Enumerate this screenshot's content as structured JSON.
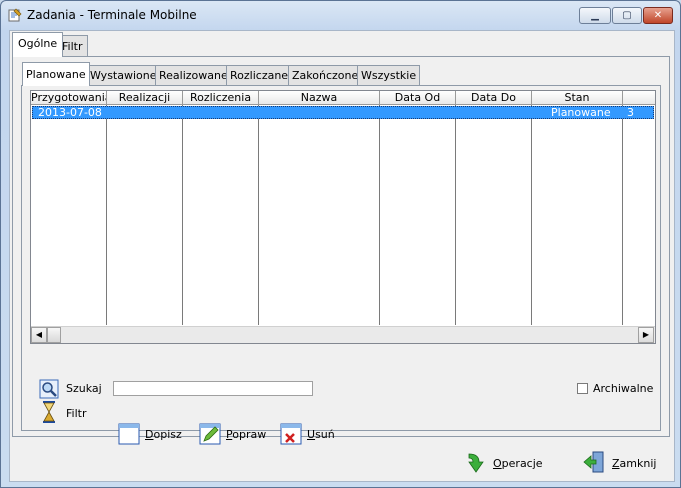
{
  "window": {
    "title": "Zadania - Terminale Mobilne",
    "controls": {
      "minimize": "▁",
      "maximize": "▢",
      "close": "✕"
    }
  },
  "outer_tabs": [
    "Ogólne",
    "Filtr"
  ],
  "inner_tabs": [
    "Planowane",
    "Wystawione",
    "Realizowane",
    "Rozliczane",
    "Zakończone",
    "Wszystkie"
  ],
  "grid": {
    "columns": [
      "Przygotowania",
      "Realizacji",
      "Rozliczenia",
      "Nazwa",
      "Data Od",
      "Data Do",
      "Stan",
      ""
    ],
    "rows": [
      {
        "przygotowania": "2013-07-08",
        "stan": "Planowane",
        "extra": "3"
      }
    ],
    "scroll": {
      "left": "◀",
      "right": "▶"
    }
  },
  "search": {
    "label": "Szukaj",
    "value": ""
  },
  "filter": {
    "label": "Filtr"
  },
  "archive": {
    "label": "Archiwalne",
    "checked": false
  },
  "actions": {
    "add": {
      "label": "Dopisz",
      "accel": "D",
      "rest": "opisz"
    },
    "edit": {
      "label": "Popraw",
      "accel": "P",
      "rest": "opraw"
    },
    "delete": {
      "label": "Usuń",
      "accel": "U",
      "rest": "suń"
    }
  },
  "footer": {
    "operations": {
      "label": "Operacje",
      "accel": "O",
      "rest": "peracje"
    },
    "close": {
      "label": "Zamknij",
      "accel": "Z",
      "rest": "amknij"
    }
  },
  "colors": {
    "selection": "#3399ff",
    "panel": "#f0f0f0",
    "frame": "#c9d9ec"
  }
}
